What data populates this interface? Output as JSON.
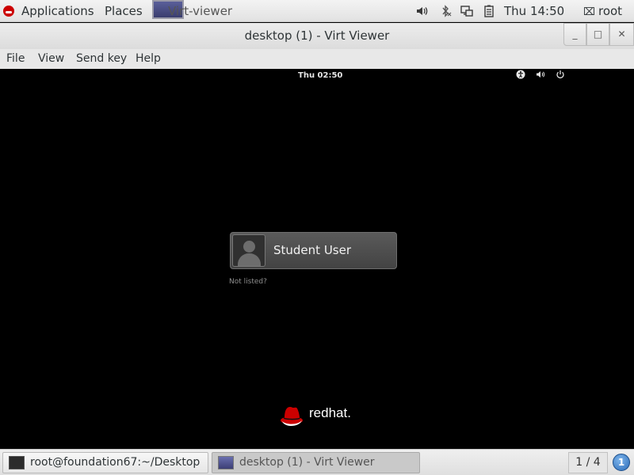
{
  "top_panel": {
    "applications_label": "Applications",
    "places_label": "Places",
    "launcher_label": "Virt-viewer",
    "clock": "Thu 14:50",
    "user": "root"
  },
  "window": {
    "title": "desktop (1) - Virt Viewer",
    "min_glyph": "_",
    "max_glyph": "□",
    "close_glyph": "✕"
  },
  "menubar": {
    "file": "File",
    "view": "View",
    "send_key": "Send key",
    "help": "Help"
  },
  "vm": {
    "clock": "Thu 02:50",
    "user_name": "Student User",
    "not_listed": "Not listed?",
    "brand_word": "redhat."
  },
  "taskbar": {
    "terminal_label": "root@foundation67:~/Desktop",
    "virt_label": "desktop (1) - Virt Viewer",
    "workspace": "1 / 4",
    "notification_count": "1"
  },
  "colors": {
    "redhat_red": "#cc0000",
    "vm_background": "#000000"
  }
}
